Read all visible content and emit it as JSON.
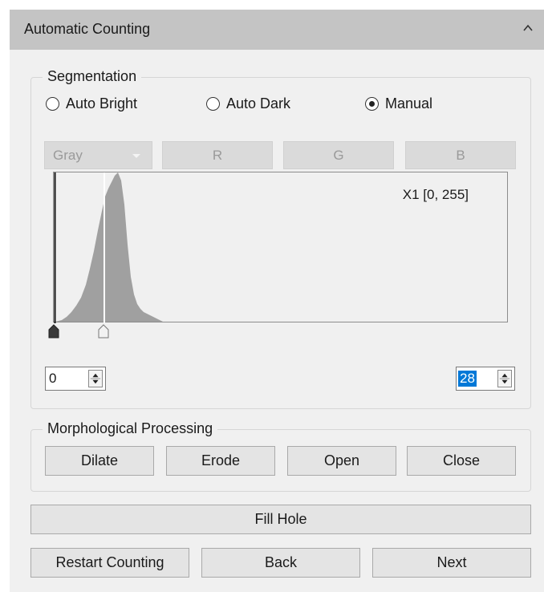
{
  "panel": {
    "title": "Automatic Counting",
    "collapse_icon": "chevron-up-icon"
  },
  "segmentation": {
    "title": "Segmentation",
    "modes": [
      {
        "label": "Auto Bright",
        "checked": false
      },
      {
        "label": "Auto Dark",
        "checked": false
      },
      {
        "label": "Manual",
        "checked": true
      }
    ],
    "channel_select": "Gray",
    "channel_buttons": [
      "R",
      "G",
      "B"
    ],
    "histogram": {
      "range_label": "X1 [0, 255]",
      "low_threshold": 0,
      "high_threshold": 28
    },
    "low_value": "0",
    "high_value": "28"
  },
  "morphology": {
    "title": "Morphological Processing",
    "buttons": [
      "Dilate",
      "Erode",
      "Open",
      "Close"
    ]
  },
  "actions": {
    "fill_hole": "Fill Hole",
    "restart": "Restart Counting",
    "back": "Back",
    "next": "Next"
  },
  "colors": {
    "header": "#c4c4c4",
    "selection": "#0078d7",
    "histogram_fill": "#a0a0a0"
  }
}
